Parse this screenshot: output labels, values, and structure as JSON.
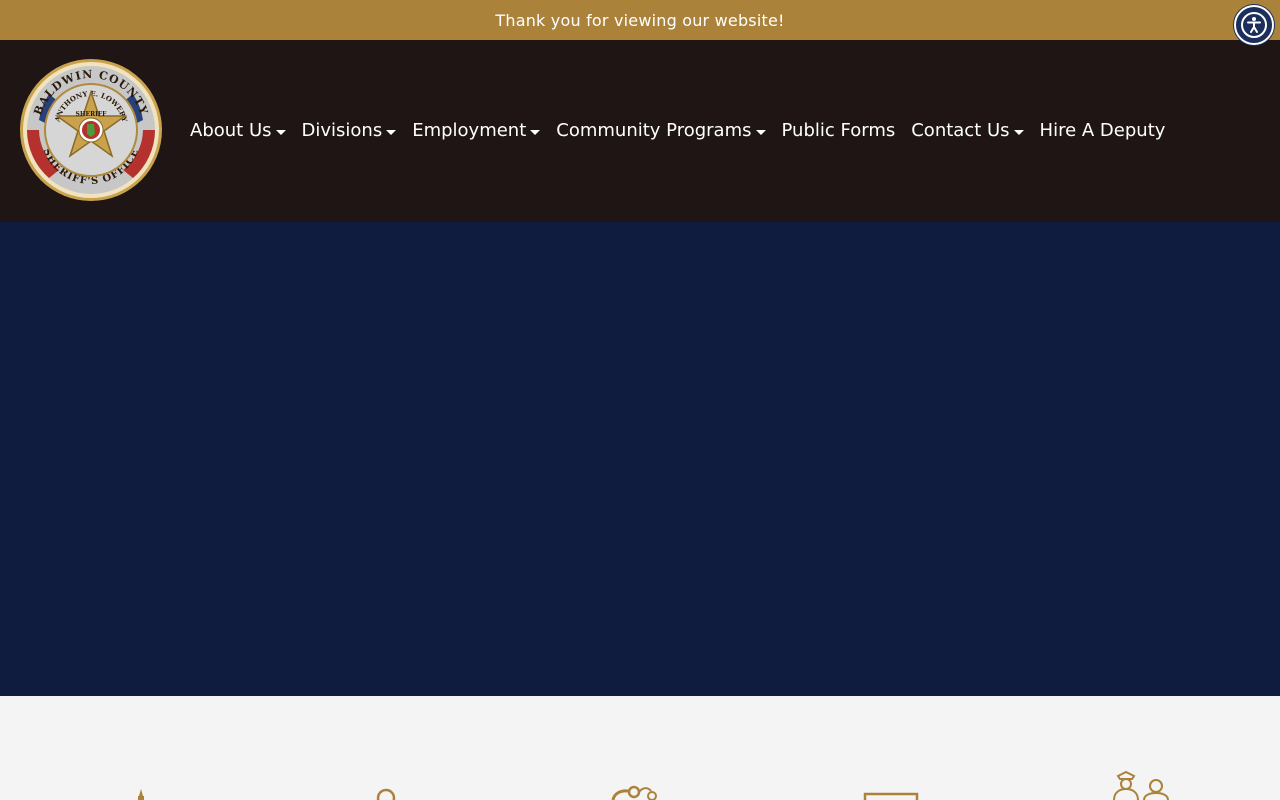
{
  "announcement": {
    "text": "Thank you for viewing our website!"
  },
  "accessibility": {
    "icon": "accessibility-icon",
    "color": "#1c2e5b"
  },
  "logo": {
    "alt": "Baldwin County Sheriff's Office seal",
    "ring_top": "BALDWIN COUNTY",
    "ring_bottom": "SHERIFF'S OFFICE",
    "inner_name": "ANTHONY E. LOWERY",
    "inner_title": "SHERIFF"
  },
  "nav": {
    "items": [
      {
        "label": "About Us",
        "dropdown": true
      },
      {
        "label": "Divisions",
        "dropdown": true
      },
      {
        "label": "Employment",
        "dropdown": true
      },
      {
        "label": "Community Programs",
        "dropdown": true
      },
      {
        "label": "Public Forms",
        "dropdown": false
      },
      {
        "label": "Contact Us",
        "dropdown": true
      },
      {
        "label": "Hire A Deputy",
        "dropdown": false
      }
    ]
  },
  "feature_icons": [
    "monument-icon",
    "search-icon",
    "handcuffs-icon",
    "document-icon",
    "community-officers-icon"
  ],
  "colors": {
    "gold": "#ab8239",
    "nav_bg": "#1f1514",
    "hero_bg": "#0f1b3f",
    "section_bg": "#f4f4f4"
  }
}
